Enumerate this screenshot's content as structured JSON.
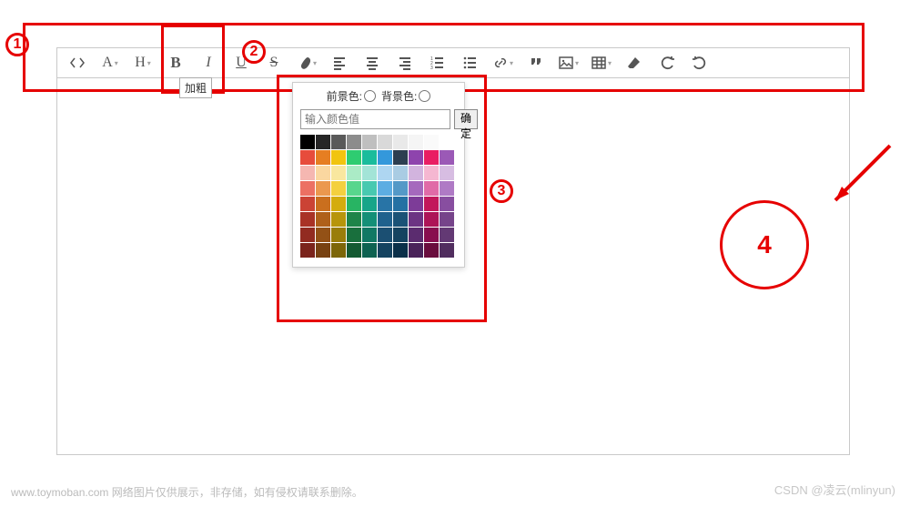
{
  "toolbar": {
    "bold_tooltip": "加粗"
  },
  "color_panel": {
    "fg_label": "前景色:",
    "bg_label": "背景色:",
    "input_placeholder": "输入颜色值",
    "confirm": "确定",
    "swatches": [
      "#000000",
      "#262626",
      "#595959",
      "#8c8c8c",
      "#bfbfbf",
      "#d9d9d9",
      "#e9e9e9",
      "#f5f5f5",
      "#fafafa",
      "#ffffff",
      "#e74c3c",
      "#e67e22",
      "#f1c40f",
      "#2ecc71",
      "#1abc9c",
      "#3498db",
      "#2c3e50",
      "#8e44ad",
      "#e91e63",
      "#9b59b6",
      "#f5b7b1",
      "#fad7a0",
      "#f9e79f",
      "#abebc6",
      "#a3e4d7",
      "#aed6f1",
      "#a9cce3",
      "#d2b4de",
      "#f5b7d1",
      "#d7bde2",
      "#ec7063",
      "#eb984e",
      "#f4d03f",
      "#58d68d",
      "#48c9b0",
      "#5dade2",
      "#5499c7",
      "#a569bd",
      "#e06ba7",
      "#af7ac5",
      "#cb4335",
      "#ca6f1e",
      "#d4ac0d",
      "#28b463",
      "#17a589",
      "#2874a6",
      "#2471a3",
      "#7d3c98",
      "#c2185b",
      "#884ea0",
      "#a93226",
      "#af601a",
      "#b7950b",
      "#1e8449",
      "#148f77",
      "#1f618d",
      "#1a5276",
      "#6c3483",
      "#ad1457",
      "#76448a",
      "#922b21",
      "#935116",
      "#9a7d0a",
      "#196f3d",
      "#117864",
      "#1b4f72",
      "#154360",
      "#5b2c6f",
      "#880e4f",
      "#633974",
      "#7b241c",
      "#784212",
      "#7d6608",
      "#145a32",
      "#0e6251",
      "#154360",
      "#0b3049",
      "#4a235a",
      "#6a0c3d",
      "#512e5f"
    ]
  },
  "callouts": {
    "n1": "1",
    "n2": "2",
    "n3": "3",
    "n4": "4"
  },
  "footer": {
    "left": "www.toymoban.com  网络图片仅供展示，非存储，如有侵权请联系删除。",
    "right": "CSDN @凌云(mlinyun)"
  }
}
